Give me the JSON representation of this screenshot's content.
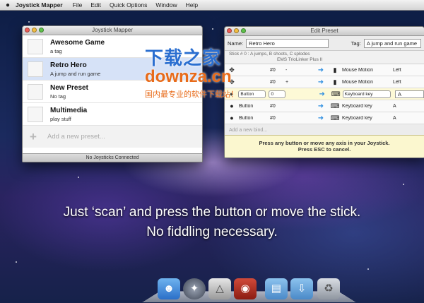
{
  "menubar": {
    "apple": "",
    "app_name": "Joystick Mapper",
    "items": [
      "File",
      "Edit",
      "Quick Options",
      "Window",
      "Help"
    ]
  },
  "main_window": {
    "title": "Joystick Mapper",
    "presets": [
      {
        "name": "Awesome Game",
        "tag": "a tag",
        "selected": false
      },
      {
        "name": "Retro Hero",
        "tag": "A jump and run game",
        "selected": true
      },
      {
        "name": "New Preset",
        "tag": "No tag",
        "selected": false
      },
      {
        "name": "Multimedia",
        "tag": "play stuff",
        "selected": false
      }
    ],
    "add_preset_label": "Add a new preset...",
    "status": "No Joysticks Connected"
  },
  "edit_window": {
    "title": "Edit Preset",
    "name_label": "Name:",
    "name_value": "Retro Hero",
    "tag_label": "Tag:",
    "tag_value": "A jump and run game",
    "header_line1": "Stick # 0 :  A jumps, B shoots, C splodes",
    "header_line2": "EMS TrioLinker Plus II",
    "rows": [
      {
        "input": "",
        "index": "#0",
        "sign": "-",
        "action": "Mouse Motion",
        "value": "Left"
      },
      {
        "input": "",
        "index": "#0",
        "sign": "+",
        "action": "Mouse Motion",
        "value": "Left"
      },
      {
        "input": "Button",
        "index": "0",
        "sign": "",
        "action": "Keyboard key",
        "value": "A"
      },
      {
        "input": "Button",
        "index": "#0",
        "sign": "",
        "action": "Keyboard key",
        "value": "A"
      },
      {
        "input": "Button",
        "index": "#0",
        "sign": "",
        "action": "Keyboard key",
        "value": "A"
      }
    ],
    "ghost_row": "Add a new bind...",
    "prompt_line1": "Press any button or move any axis in your Joystick.",
    "prompt_line2": "Press ESC to cancel."
  },
  "watermark": {
    "line1": "下载之家",
    "line2": "downza.cn",
    "line3": "国内最专业的软件下载站！"
  },
  "caption": {
    "line1": "Just ‘scan’ and press the button or move the stick.",
    "line2": "No fiddling necessary."
  },
  "colors": {
    "selected_row": "#d6e2f7",
    "highlight_row": "#fdf9d6",
    "arrow_blue": "#2f8fe0",
    "watermark_blue": "#2b6fd0",
    "watermark_orange": "#e86b1a"
  }
}
